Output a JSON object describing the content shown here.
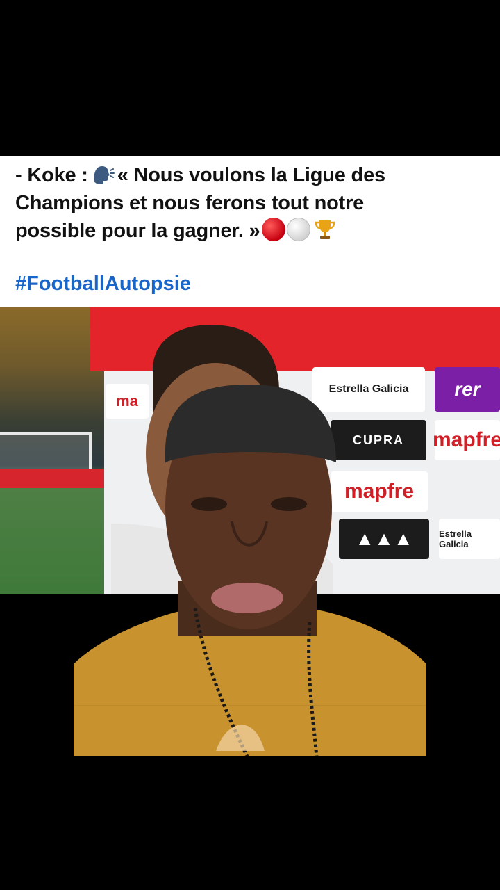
{
  "post": {
    "line1_prefix": "- Koke  :",
    "line1_rest": "« Nous voulons la Ligue des",
    "line2": "Champions et nous ferons tout notre",
    "line3": "possible pour la gagner. »",
    "hashtag": "#FootballAutopsie",
    "icons": [
      "speaking-head-icon",
      "red-circle-icon",
      "white-circle-icon",
      "trophy-icon"
    ]
  },
  "video": {
    "sponsors": [
      "Estrella Galicia",
      "CUPRA",
      "mapfre",
      "mapfre",
      "ma",
      "rer",
      "Estrella Galicia"
    ]
  },
  "colors": {
    "hashtag": "#1a66c8",
    "board_red": "#e3252b",
    "background": "#000000"
  }
}
